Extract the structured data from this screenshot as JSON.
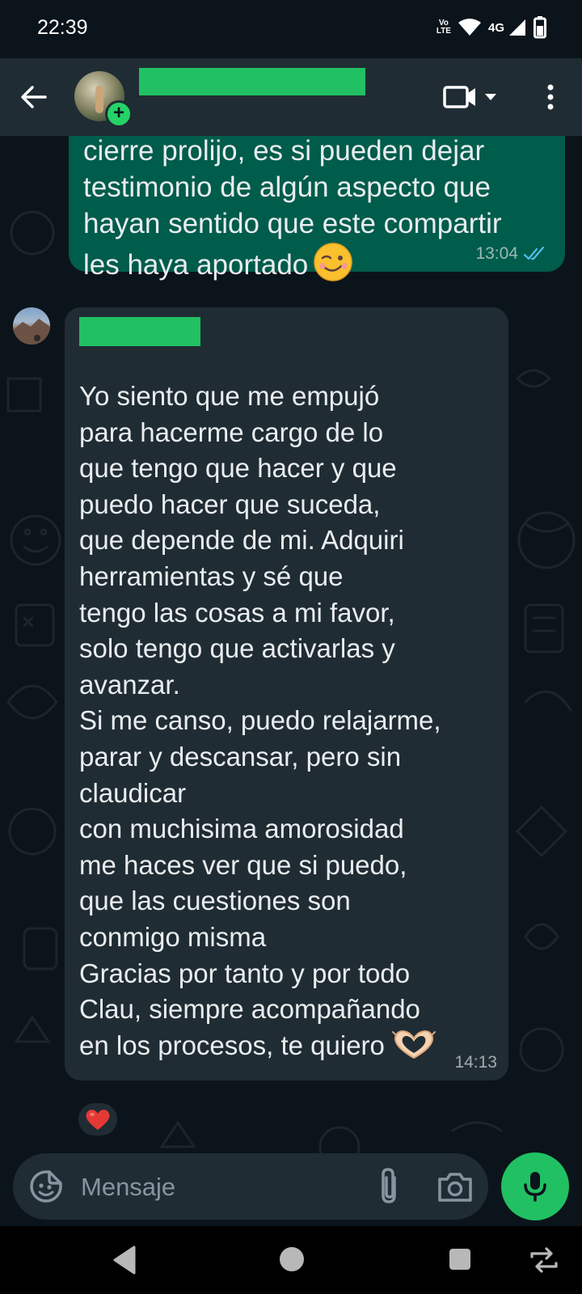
{
  "status_bar": {
    "time": "22:39",
    "volte_line1": "Vo",
    "volte_line2": "LTE",
    "network": "4G"
  },
  "header": {
    "back_icon": "arrow-left-icon",
    "video_icon": "video-camera-icon",
    "menu_icon": "more-vertical-icon"
  },
  "messages": [
    {
      "direction": "outgoing",
      "text": "cierre prolijo, es si pueden dejar\ntestimonio de algún aspecto que\nhayan sentido que este compartir\nles haya aportado",
      "emoji": "winking-face",
      "time": "13:04",
      "status": "read"
    },
    {
      "direction": "incoming",
      "text": "Yo siento que me empujó\npara hacerme cargo de lo\nque tengo que hacer y que\npuedo hacer que suceda,\nque depende de mi. Adquiri\nherramientas y sé que\ntengo las cosas a mi favor,\nsolo tengo que activarlas y\navanzar.\nSi me canso, puedo relajarme,\nparar y descansar, pero sin\nclaudicar\ncon muchisima amorosidad\nme haces ver que si puedo,\nque las cuestiones son\nconmigo misma\nGracias por tanto y por todo\nClau, siempre acompañando\nen los procesos, te quiero",
      "emoji": "heart-hands",
      "time": "14:13",
      "reaction": "red-heart"
    }
  ],
  "composer": {
    "placeholder": "Mensaje"
  },
  "colors": {
    "chat_background": "#0b141a",
    "header": "#1f2c34",
    "outgoing_bubble": "#005c4b",
    "incoming_bubble": "#202c33",
    "accent_green": "#21c063",
    "read_tick": "#53bdeb"
  }
}
